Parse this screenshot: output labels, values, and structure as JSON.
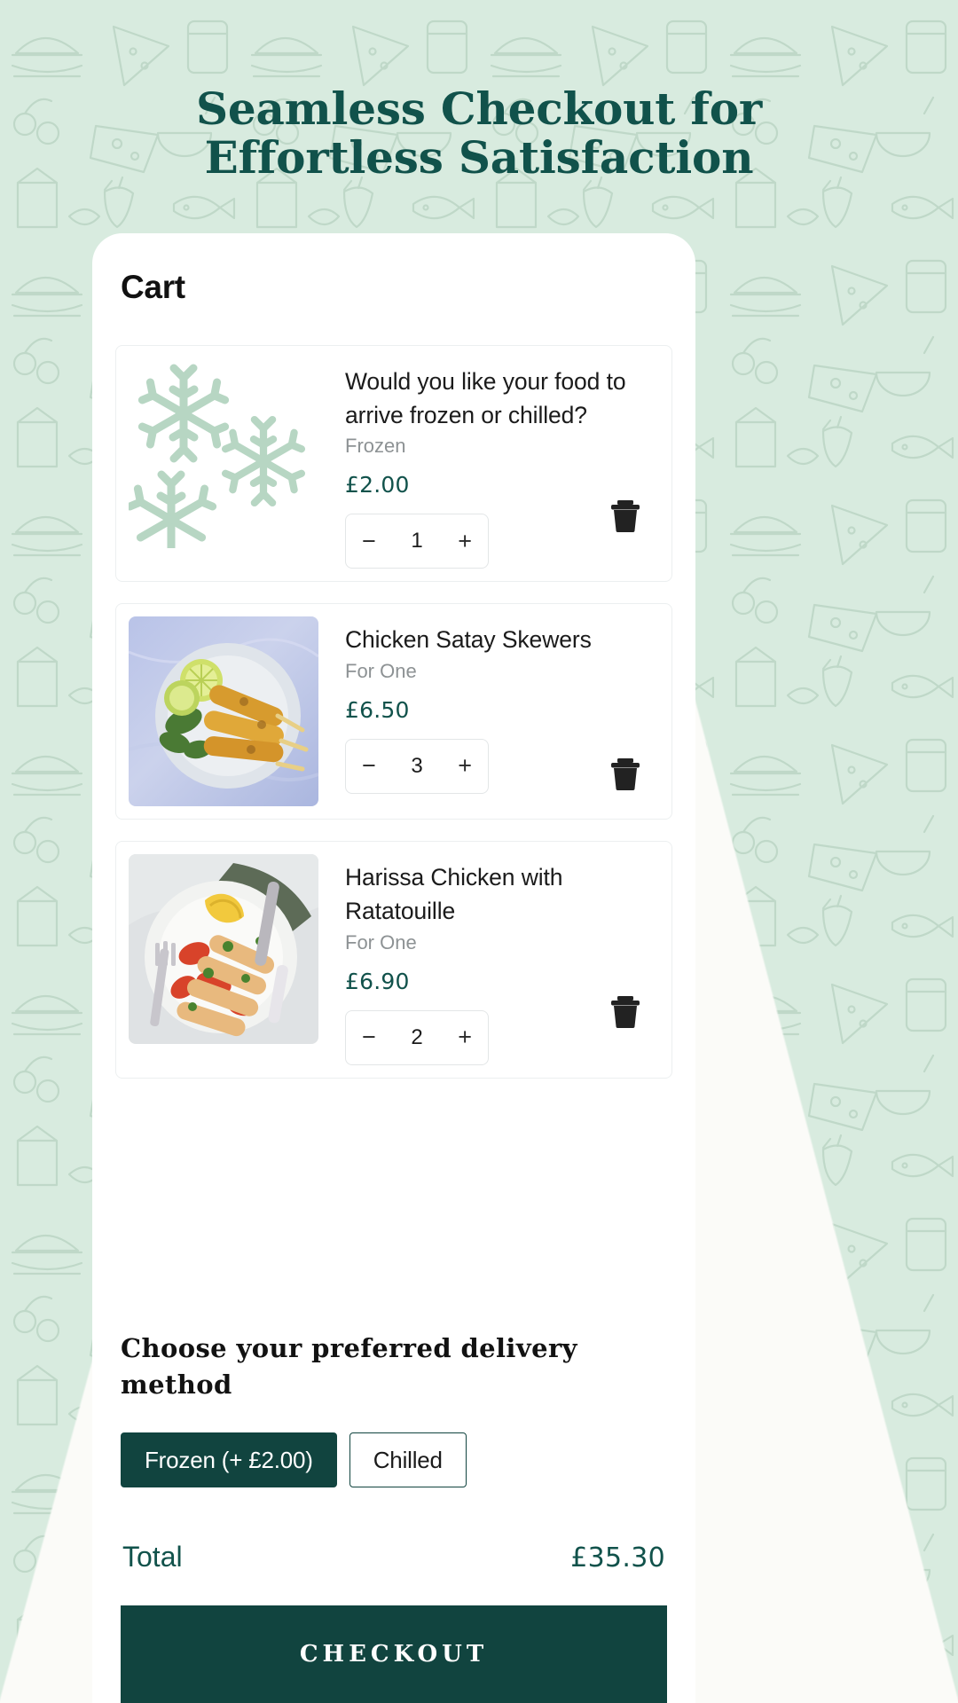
{
  "page": {
    "headline": "Seamless Checkout for Effortless Satisfaction",
    "background_color": "#d8ebdf",
    "accent_color": "#11443f",
    "price_color": "#11524b"
  },
  "cart": {
    "title": "Cart",
    "items": [
      {
        "icon": "snowflake-icon",
        "name": "Would you like your food to arrive frozen or chilled?",
        "variant": "Frozen",
        "price": "£2.00",
        "quantity": "1",
        "decrement_label": "−",
        "increment_label": "+",
        "remove_label": "trash-icon"
      },
      {
        "icon": "food-photo",
        "name": "Chicken Satay Skewers",
        "variant": "For One",
        "price": "£6.50",
        "quantity": "3",
        "decrement_label": "−",
        "increment_label": "+",
        "remove_label": "trash-icon"
      },
      {
        "icon": "food-photo",
        "name": "Harissa Chicken with Ratatouille",
        "variant": "For One",
        "price": "£6.90",
        "quantity": "2",
        "decrement_label": "−",
        "increment_label": "+",
        "remove_label": "trash-icon"
      }
    ]
  },
  "delivery": {
    "heading": "Choose your preferred delivery method",
    "options": [
      {
        "label": "Frozen (+ £2.00)",
        "selected": true
      },
      {
        "label": "Chilled",
        "selected": false
      }
    ]
  },
  "summary": {
    "total_label": "Total",
    "total_value": "£35.30",
    "checkout_label": "CHECKOUT"
  }
}
